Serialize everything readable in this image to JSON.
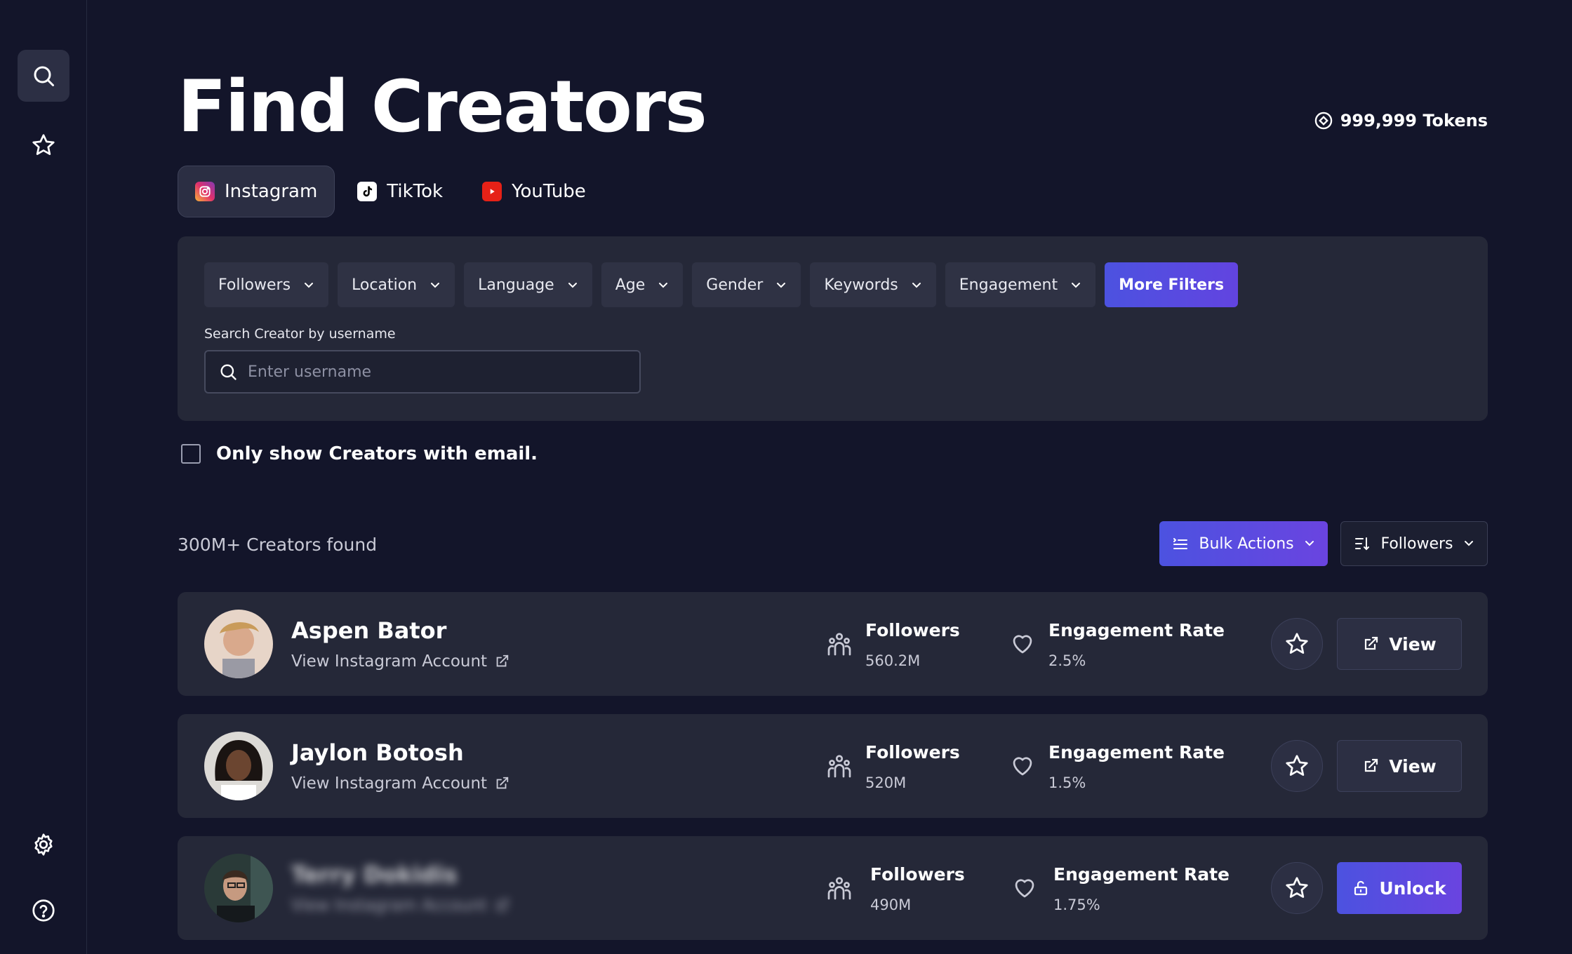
{
  "sidebar": {
    "items": [
      {
        "icon": "search-icon"
      },
      {
        "icon": "star-icon"
      },
      {
        "icon": "gear-icon"
      },
      {
        "icon": "help-icon"
      }
    ]
  },
  "header": {
    "title": "Find Creators",
    "tokens": "999,999 Tokens"
  },
  "platform_tabs": [
    {
      "label": "Instagram",
      "icon": "instagram-icon",
      "active": true
    },
    {
      "label": "TikTok",
      "icon": "tiktok-icon",
      "active": false
    },
    {
      "label": "YouTube",
      "icon": "youtube-icon",
      "active": false
    }
  ],
  "filters": {
    "items": [
      "Followers",
      "Location",
      "Language",
      "Age",
      "Gender",
      "Keywords",
      "Engagement"
    ],
    "more_label": "More Filters",
    "search_label": "Search Creator by username",
    "search_placeholder": "Enter username"
  },
  "email_filter": {
    "label": "Only show Creators with email.",
    "checked": false
  },
  "results": {
    "count": "300M+ Creators found",
    "bulk_label": "Bulk Actions",
    "sort_label": "Followers"
  },
  "creators": [
    {
      "name": "Aspen Bator",
      "link": "View Instagram Account",
      "followers_label": "Followers",
      "followers": "560.2M",
      "engagement_label": "Engagement Rate",
      "engagement": "2.5%",
      "action": "View",
      "locked": false
    },
    {
      "name": "Jaylon Botosh",
      "link": "View Instagram Account",
      "followers_label": "Followers",
      "followers": "520M",
      "engagement_label": "Engagement Rate",
      "engagement": "1.5%",
      "action": "View",
      "locked": false
    },
    {
      "name": "Terry Dokidis",
      "link": "View Instagram Account",
      "followers_label": "Followers",
      "followers": "490M",
      "engagement_label": "Engagement Rate",
      "engagement": "1.75%",
      "action": "Unlock",
      "locked": true
    }
  ],
  "colors": {
    "background": "#13152a",
    "panel": "#252838",
    "accent_start": "#4c52e0",
    "accent_end": "#6a44e0"
  }
}
